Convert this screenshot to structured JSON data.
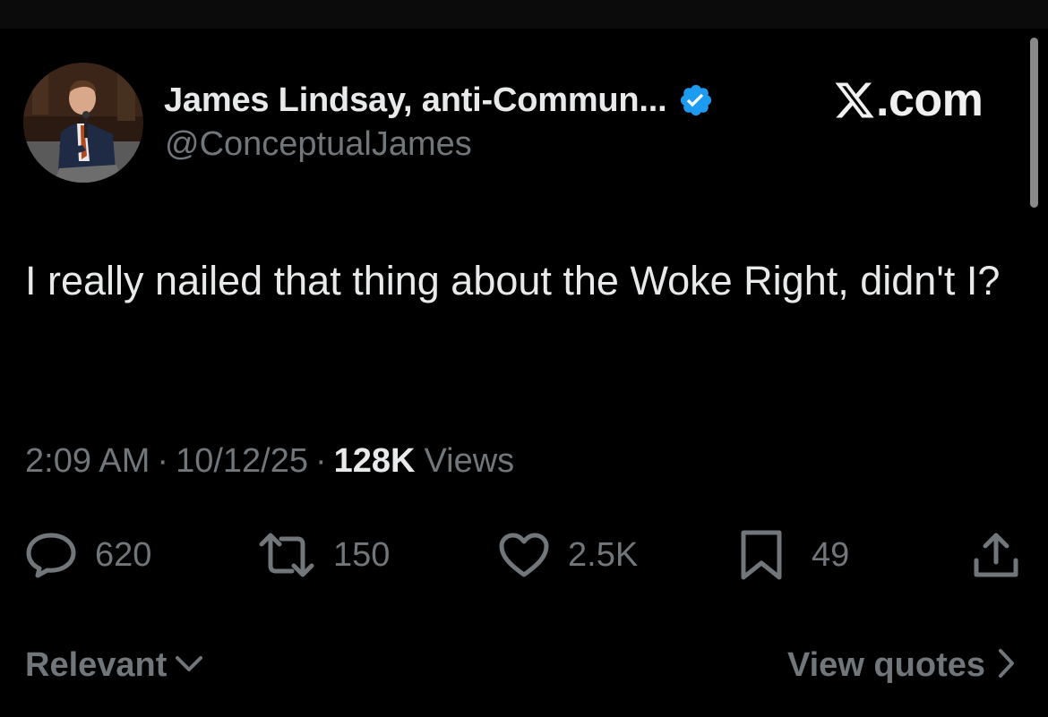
{
  "author": {
    "display_name": "James Lindsay, anti-Commun...",
    "handle": "@ConceptualJames",
    "verified": true
  },
  "watermark": {
    "text": ".com",
    "logo_icon": "x-logo-icon"
  },
  "tweet": {
    "text": "I really nailed that thing about the Woke Right, didn't I?",
    "time": "2:09 AM",
    "date": "10/12/25",
    "views_count": "128K",
    "views_label": "Views",
    "separator": "·"
  },
  "actions": {
    "replies": "620",
    "reposts": "150",
    "likes": "2.5K",
    "bookmarks": "49"
  },
  "footer": {
    "sort_label": "Relevant",
    "quotes_label": "View quotes"
  },
  "colors": {
    "background": "#000000",
    "text_primary": "#e7e9ea",
    "text_secondary": "#71767b",
    "verified_badge": "#1d9bf0"
  }
}
